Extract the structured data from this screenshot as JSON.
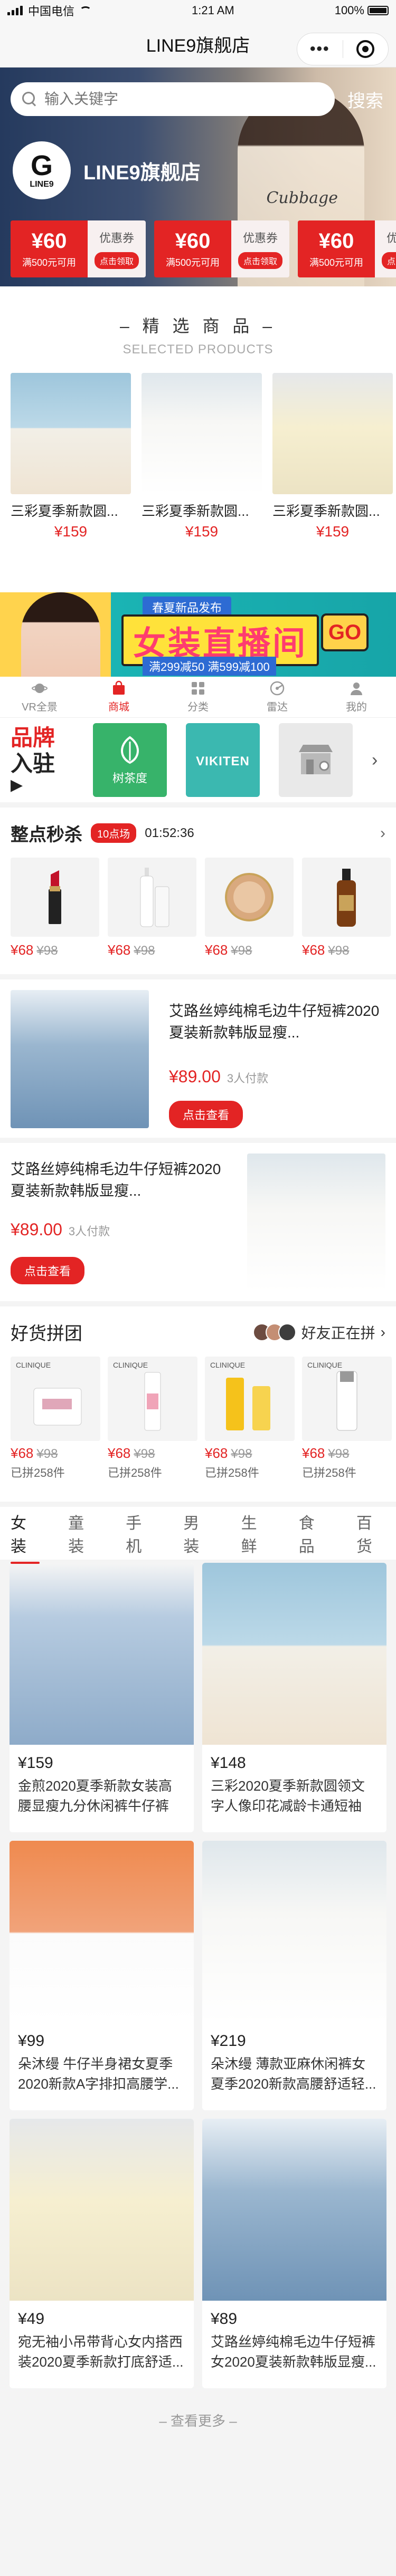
{
  "status": {
    "carrier": "中国电信",
    "time": "1:21 AM",
    "battery": "100%"
  },
  "nav": {
    "title": "LINE9旗舰店"
  },
  "search": {
    "placeholder": "输入关键字",
    "button": "搜索"
  },
  "store": {
    "logo_text": "LINE9",
    "name": "LINE9旗舰店",
    "hero_text": "Cubbage"
  },
  "coupons": [
    {
      "amount": "¥60",
      "condition": "满500元可用",
      "type": "优惠券",
      "action": "点击领取"
    },
    {
      "amount": "¥60",
      "condition": "满500元可用",
      "type": "优惠券",
      "action": "点击领取"
    },
    {
      "amount": "¥60",
      "condition": "满500元可用",
      "type": "优惠券",
      "action": "点击领取"
    }
  ],
  "selected": {
    "title": "– 精 选 商 品 –",
    "subtitle": "SELECTED PRODUCTS",
    "items": [
      {
        "name": "三彩夏季新款圆...",
        "price": "¥159"
      },
      {
        "name": "三彩夏季新款圆...",
        "price": "¥159"
      },
      {
        "name": "三彩夏季新款圆...",
        "price": "¥159"
      }
    ]
  },
  "live_banner": {
    "tag": "春夏新品发布",
    "title": "女装直播间",
    "sub": "满299减50 满599减100",
    "go": "GO"
  },
  "tabbar": [
    {
      "label": "VR全景",
      "icon": "planet-icon"
    },
    {
      "label": "商城",
      "icon": "bag-icon"
    },
    {
      "label": "分类",
      "icon": "grid-icon"
    },
    {
      "label": "雷达",
      "icon": "radar-icon"
    },
    {
      "label": "我的",
      "icon": "user-icon"
    }
  ],
  "brands": {
    "heading_line1": "品牌",
    "heading_line2": "入驻",
    "items": [
      {
        "name": "树茶度",
        "color": "#37b36a"
      },
      {
        "name": "VIKITEN",
        "color": "#3bb8b0"
      },
      {
        "name": "",
        "color": "#e9e9e9"
      }
    ]
  },
  "seckill": {
    "title": "整点秒杀",
    "session": "10点场",
    "countdown": "01:52:36",
    "items": [
      {
        "price": "¥68",
        "original": "¥98"
      },
      {
        "price": "¥68",
        "original": "¥98"
      },
      {
        "price": "¥68",
        "original": "¥98"
      },
      {
        "price": "¥68",
        "original": "¥98"
      }
    ]
  },
  "features": [
    {
      "title": "艾路丝婷纯棉毛边牛仔短裤2020夏装新款韩版显瘦...",
      "price": "¥89.00",
      "sold": "3人付款",
      "button": "点击查看"
    },
    {
      "title": "艾路丝婷纯棉毛边牛仔短裤2020夏装新款韩版显瘦...",
      "price": "¥89.00",
      "sold": "3人付款",
      "button": "点击查看"
    }
  ],
  "group": {
    "title": "好货拼团",
    "friends": "好友正在拼",
    "items": [
      {
        "brand": "CLINIQUE",
        "price": "¥68",
        "original": "¥98",
        "count": "已拼258件"
      },
      {
        "brand": "CLINIQUE",
        "price": "¥68",
        "original": "¥98",
        "count": "已拼258件"
      },
      {
        "brand": "CLINIQUE",
        "price": "¥68",
        "original": "¥98",
        "count": "已拼258件"
      },
      {
        "brand": "CLINIQUE",
        "price": "¥68",
        "original": "¥98",
        "count": "已拼258件"
      }
    ]
  },
  "categories": [
    "女装",
    "童装",
    "手机",
    "男装",
    "生鲜",
    "食品",
    "百货"
  ],
  "products": [
    {
      "price": "¥159",
      "name": "金煎2020夏季新款女装高腰显瘦九分休闲裤牛仔裤女..."
    },
    {
      "price": "¥148",
      "name": "三彩2020夏季新款圆领文字人像印花减龄卡通短袖直..."
    },
    {
      "price": "¥99",
      "name": "朵沐缦 牛仔半身裙女夏季2020新款A字排扣高腰学..."
    },
    {
      "price": "¥219",
      "name": "朵沐缦 薄款亚麻休闲裤女夏季2020新款高腰舒适轻..."
    },
    {
      "price": "¥49",
      "name": "宛无袖小吊带背心女内搭西装2020夏季新款打底舒适..."
    },
    {
      "price": "¥89",
      "name": "艾路丝婷纯棉毛边牛仔短裤女2020夏装新款韩版显瘦..."
    }
  ],
  "more": "– 查看更多 –"
}
